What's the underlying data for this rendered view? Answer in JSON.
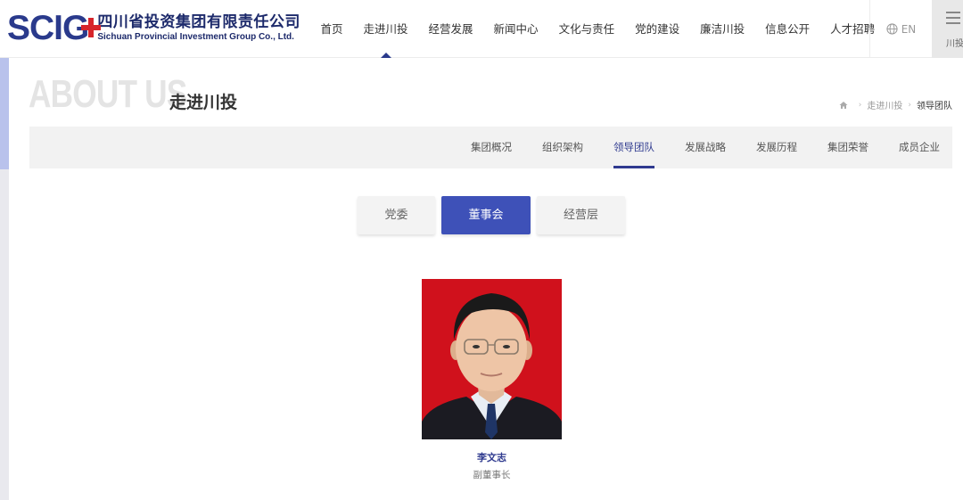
{
  "header": {
    "logo": {
      "mark": "SCIG",
      "name_cn": "四川省投资集团有限责任公司",
      "name_en": "Sichuan Provincial Investment Group Co., Ltd."
    },
    "nav": [
      "首页",
      "走进川投",
      "经营发展",
      "新闻中心",
      "文化与责任",
      "党的建设",
      "廉洁川投",
      "信息公开",
      "人才招聘"
    ],
    "active_nav": "走进川投",
    "lang_label": "EN",
    "menu_label": "川投"
  },
  "banner": {
    "big_title": "ABOUT US",
    "page_title": "走进川投",
    "breadcrumb": [
      "走进川投",
      "领导团队"
    ]
  },
  "subnav": {
    "items": [
      "集团概况",
      "组织架构",
      "领导团队",
      "发展战略",
      "发展历程",
      "集团荣誉",
      "成员企业"
    ],
    "active": "领导团队"
  },
  "tabs": {
    "items": [
      "党委",
      "董事会",
      "经营层"
    ],
    "active": "董事会"
  },
  "leader": {
    "name": "李文志",
    "title": "副董事长"
  },
  "colors": {
    "brand_blue": "#2a3a8c",
    "accent_blue": "#3e51b8",
    "logo_red": "#d7252b",
    "portrait_bg": "#d0111c"
  },
  "icons": {
    "lang": "globe-icon",
    "menu": "hamburger-icon",
    "home": "home-icon",
    "separator": "chevron-right-icon"
  }
}
